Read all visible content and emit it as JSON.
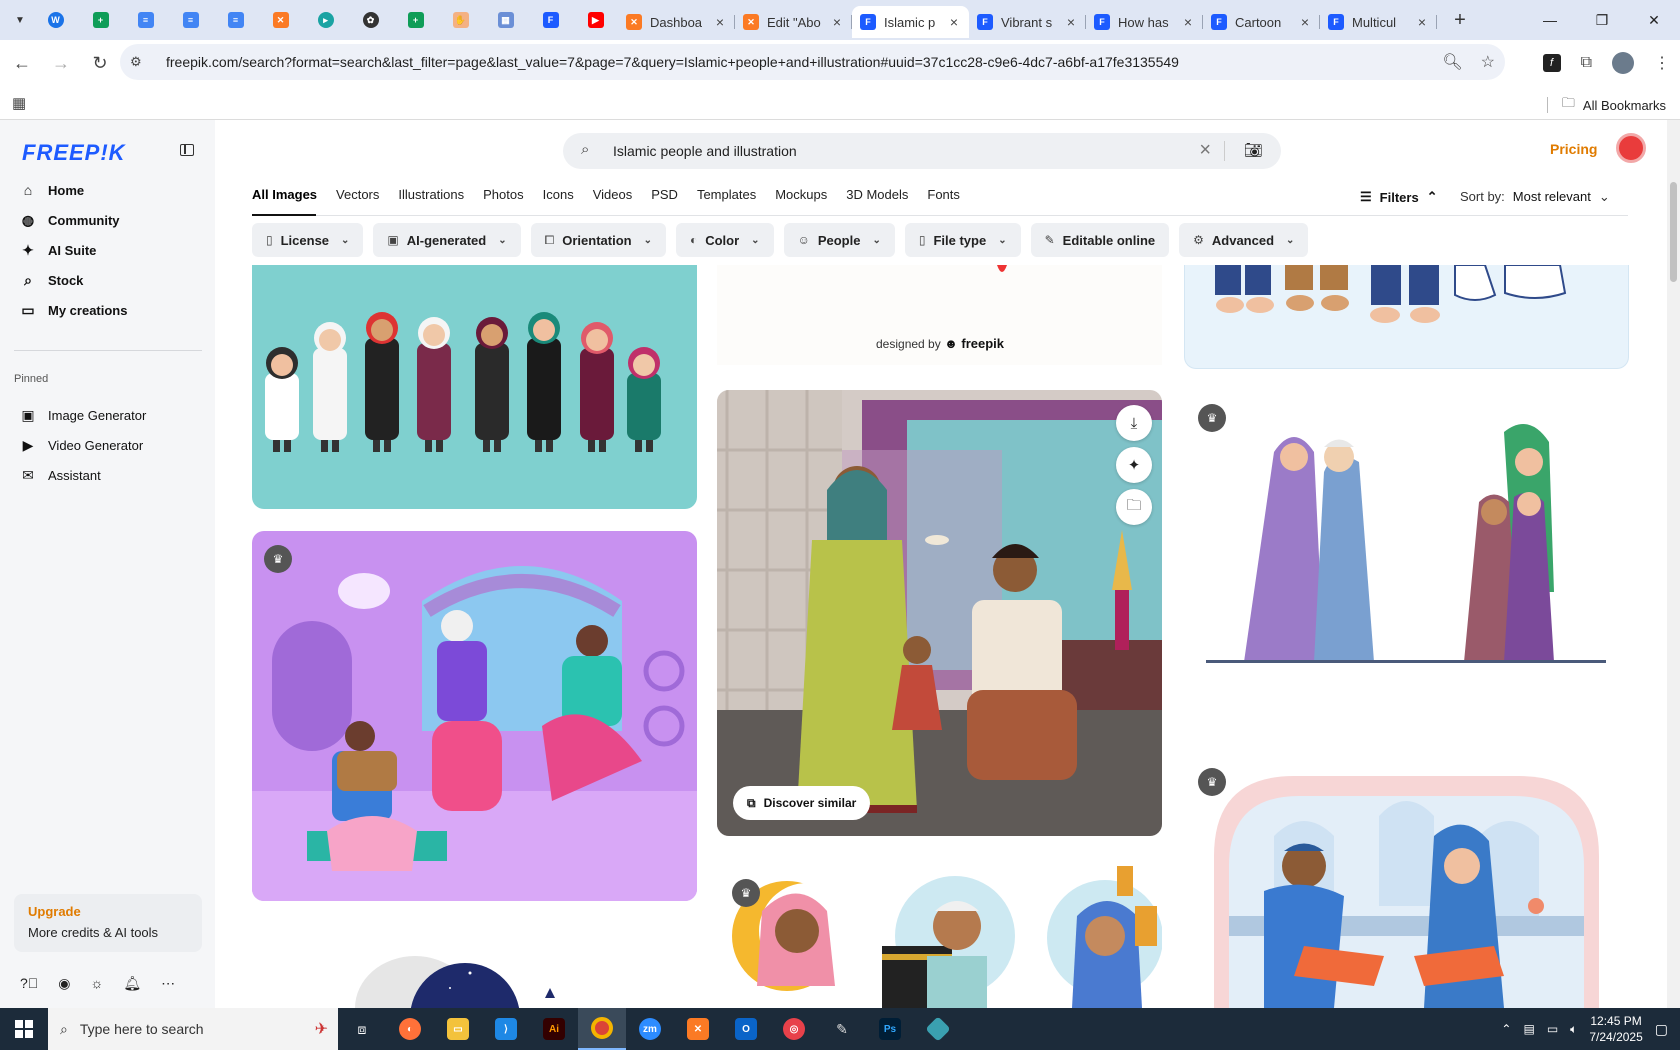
{
  "browser": {
    "tabs": [
      {
        "title": "Dashboa",
        "icon": "xampp-icon",
        "color": "#fb7a24"
      },
      {
        "title": "Edit \"Abo",
        "icon": "xampp-icon",
        "color": "#fb7a24"
      },
      {
        "title": "Islamic p",
        "icon": "freepik-icon",
        "color": "#1d5bff",
        "active": true
      },
      {
        "title": "Vibrant s",
        "icon": "freepik-icon",
        "color": "#1d5bff"
      },
      {
        "title": "How has",
        "icon": "freepik-icon",
        "color": "#1d5bff"
      },
      {
        "title": "Cartoon",
        "icon": "freepik-icon",
        "color": "#1d5bff"
      },
      {
        "title": "Multicul",
        "icon": "freepik-icon",
        "color": "#1d5bff"
      }
    ],
    "url": "freepik.com/search?format=search&last_filter=page&last_value=7&page=7&query=Islamic+people+and+illustration#uuid=37c1cc28-c9e6-4dc7-a6bf-a17fe3135549",
    "all_bookmarks": "All Bookmarks"
  },
  "sidebar": {
    "logo": "FREEP!K",
    "nav": [
      {
        "label": "Home",
        "icon": "home-icon"
      },
      {
        "label": "Community",
        "icon": "globe-icon"
      },
      {
        "label": "AI Suite",
        "icon": "sparkle-icon"
      },
      {
        "label": "Stock",
        "icon": "search-icon"
      },
      {
        "label": "My creations",
        "icon": "folder-icon"
      }
    ],
    "pinned_label": "Pinned",
    "pinned": [
      {
        "label": "Image Generator",
        "icon": "image-icon"
      },
      {
        "label": "Video Generator",
        "icon": "video-icon"
      },
      {
        "label": "Assistant",
        "icon": "chat-icon"
      }
    ],
    "upgrade_title": "Upgrade",
    "upgrade_sub": "More credits & AI tools"
  },
  "header": {
    "search_query": "Islamic people and illustration",
    "pricing": "Pricing"
  },
  "categories": [
    "All Images",
    "Vectors",
    "Illustrations",
    "Photos",
    "Icons",
    "Videos",
    "PSD",
    "Templates",
    "Mockups",
    "3D Models",
    "Fonts"
  ],
  "filters_label": "Filters",
  "sort": {
    "label": "Sort by:",
    "value": "Most relevant"
  },
  "chips": [
    "License",
    "AI-generated",
    "Orientation",
    "Color",
    "People",
    "File type",
    "Editable online",
    "Advanced"
  ],
  "grid": {
    "designed_by": "designed by",
    "designed_brand": "freepik",
    "discover_similar": "Discover similar"
  },
  "taskbar": {
    "search_placeholder": "Type here to search",
    "time": "12:45 PM",
    "date": "7/24/2025"
  }
}
